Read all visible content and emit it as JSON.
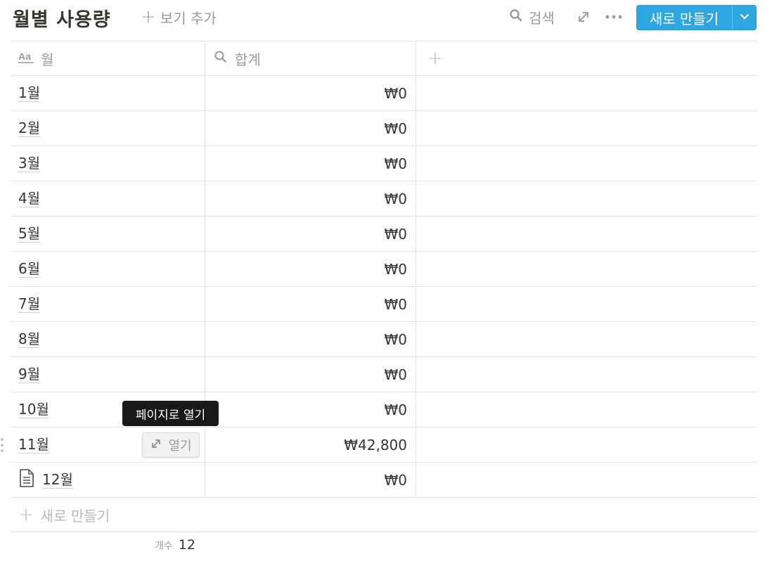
{
  "header": {
    "title": "월별 사용량",
    "add_view_label": "보기 추가",
    "search_label": "검색",
    "new_button_label": "새로 만들기"
  },
  "columns": [
    {
      "label": "월",
      "icon": "text-type-icon"
    },
    {
      "label": "합계",
      "icon": "search-icon"
    }
  ],
  "rows": [
    {
      "name": "1월",
      "amount": "₩0"
    },
    {
      "name": "2월",
      "amount": "₩0"
    },
    {
      "name": "3월",
      "amount": "₩0"
    },
    {
      "name": "4월",
      "amount": "₩0"
    },
    {
      "name": "5월",
      "amount": "₩0"
    },
    {
      "name": "6월",
      "amount": "₩0"
    },
    {
      "name": "7월",
      "amount": "₩0"
    },
    {
      "name": "8월",
      "amount": "₩0"
    },
    {
      "name": "9월",
      "amount": "₩0"
    },
    {
      "name": "10월",
      "amount": "₩0"
    },
    {
      "name": "11월",
      "amount": "₩42,800"
    },
    {
      "name": "12월",
      "amount": "₩0"
    }
  ],
  "hover": {
    "open_label": "열기",
    "tooltip": "페이지로 열기"
  },
  "footer": {
    "new_row_label": "새로 만들기",
    "count_label": "개수",
    "count_value": "12"
  },
  "colors": {
    "accent": "#2ea6e0",
    "text": "#37352f",
    "muted": "#9b9a97",
    "border": "#e3e2e0"
  }
}
